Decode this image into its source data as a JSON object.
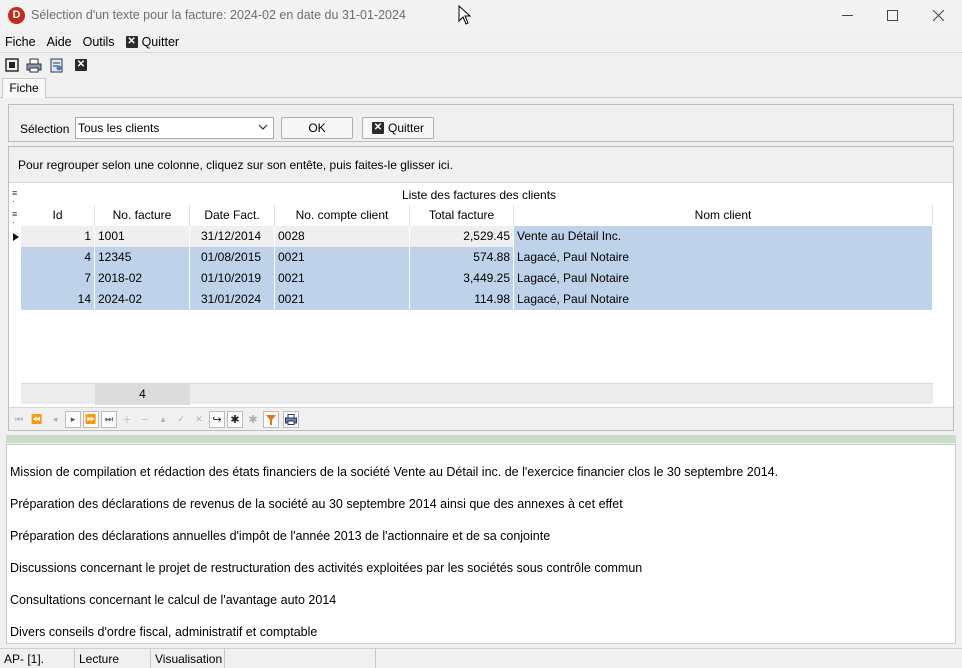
{
  "window": {
    "title": "Sélection d'un texte pour la facture: 2024-02 en date du 31-01-2024",
    "icon_letter": "D",
    "controls": [
      "minimize-icon",
      "maximize-icon",
      "close-icon"
    ]
  },
  "menu": {
    "items": [
      "Fiche",
      "Aide",
      "Outils"
    ],
    "quit_label": "Quitter"
  },
  "toolbar": {
    "icons": [
      "select-frame-icon",
      "print-icon",
      "print-preview-icon",
      "close-icon"
    ]
  },
  "tabs": [
    "Fiche"
  ],
  "selection": {
    "label": "Sélection",
    "combo_value": "Tous les clients",
    "ok_label": "OK",
    "quit_label": "Quitter"
  },
  "grid": {
    "group_hint": "Pour regrouper selon une colonne, cliquez sur son entête, puis faites-le glisser ici.",
    "caption": "Liste des factures des clients",
    "columns": [
      "Id",
      "No. facture",
      "Date Fact.",
      "No. compte client",
      "Total facture",
      "Nom client"
    ],
    "rows": [
      [
        "1",
        "1001",
        "31/12/2014",
        "0028",
        "2,529.45",
        "Vente au Détail Inc."
      ],
      [
        "4",
        "12345",
        "01/08/2015",
        "0021",
        "574.88",
        "Lagacé, Paul Notaire"
      ],
      [
        "7",
        "2018-02",
        "01/10/2019",
        "0021",
        "3,449.25",
        "Lagacé, Paul Notaire"
      ],
      [
        "14",
        "2024-02",
        "31/01/2024",
        "0021",
        "114.98",
        "Lagacé, Paul Notaire"
      ]
    ],
    "footer_count": "4",
    "nav_icons": [
      "first-page-icon",
      "prev-page-icon",
      "prev-record-icon",
      "next-record-icon",
      "next-page-icon",
      "last-page-icon",
      "insert-icon",
      "delete-icon",
      "edit-icon",
      "post-icon",
      "cancel-icon",
      "refresh-icon",
      "mark-icon",
      "unmark-icon",
      "filter-icon",
      "print-icon"
    ]
  },
  "description_lines": [
    "Mission de compilation et rédaction des états financiers de la société Vente au Détail inc. de l'exercice financier clos le 30 septembre 2014.",
    "Préparation des déclarations de revenus de la société au 30 septembre 2014 ainsi que des annexes à cet effet",
    "Préparation des déclarations annuelles d'impôt de l'année 2013 de l'actionnaire et de sa conjointe",
    "Discussions concernant le projet de restructuration des activités exploitées par les sociétés sous contrôle commun",
    "Consultations concernant le calcul de l'avantage auto 2014",
    "Divers conseils d'ordre fiscal, administratif et comptable"
  ],
  "status": {
    "cells": [
      "AP- [1].",
      "Lecture",
      "Visualisation",
      "",
      ""
    ]
  },
  "colors": {
    "selection_row": "#bed3ea",
    "splitter": "#c8dcc8",
    "app_icon": "#c42b1c"
  }
}
